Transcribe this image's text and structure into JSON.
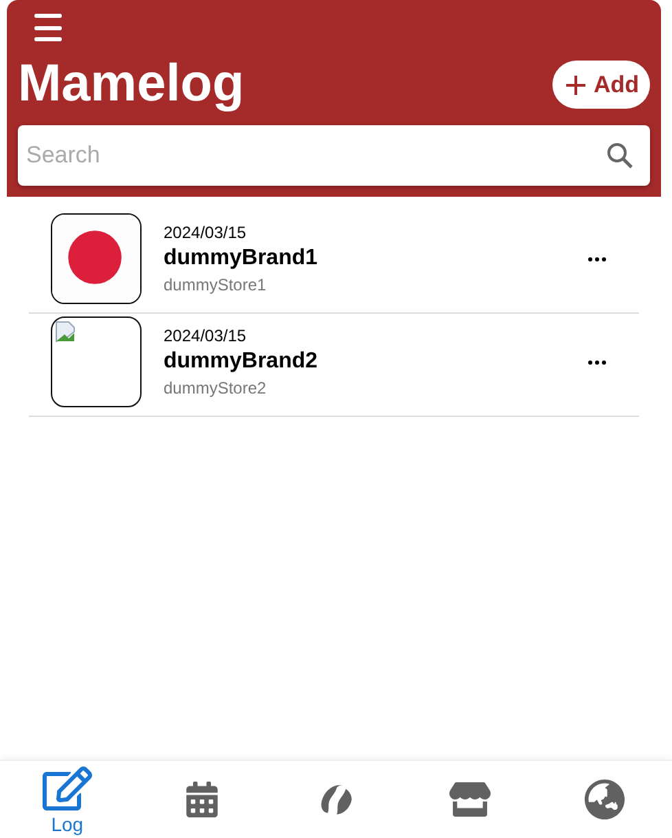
{
  "header": {
    "title": "Mamelog",
    "add_button": "Add",
    "search": {
      "placeholder": "Search"
    }
  },
  "entries": [
    {
      "date": "2024/03/15",
      "brand": "dummyBrand1",
      "store": "dummyStore1",
      "kind": "flag"
    },
    {
      "date": "2024/03/15",
      "brand": "dummyBrand2",
      "store": "dummyStore2",
      "kind": "broken"
    }
  ],
  "nav": [
    {
      "kind": "log",
      "label": "Log",
      "selected": true
    },
    {
      "kind": "calendar",
      "selected": false
    },
    {
      "kind": "bean",
      "selected": false
    },
    {
      "kind": "store",
      "selected": false
    },
    {
      "kind": "globe",
      "selected": false
    }
  ]
}
